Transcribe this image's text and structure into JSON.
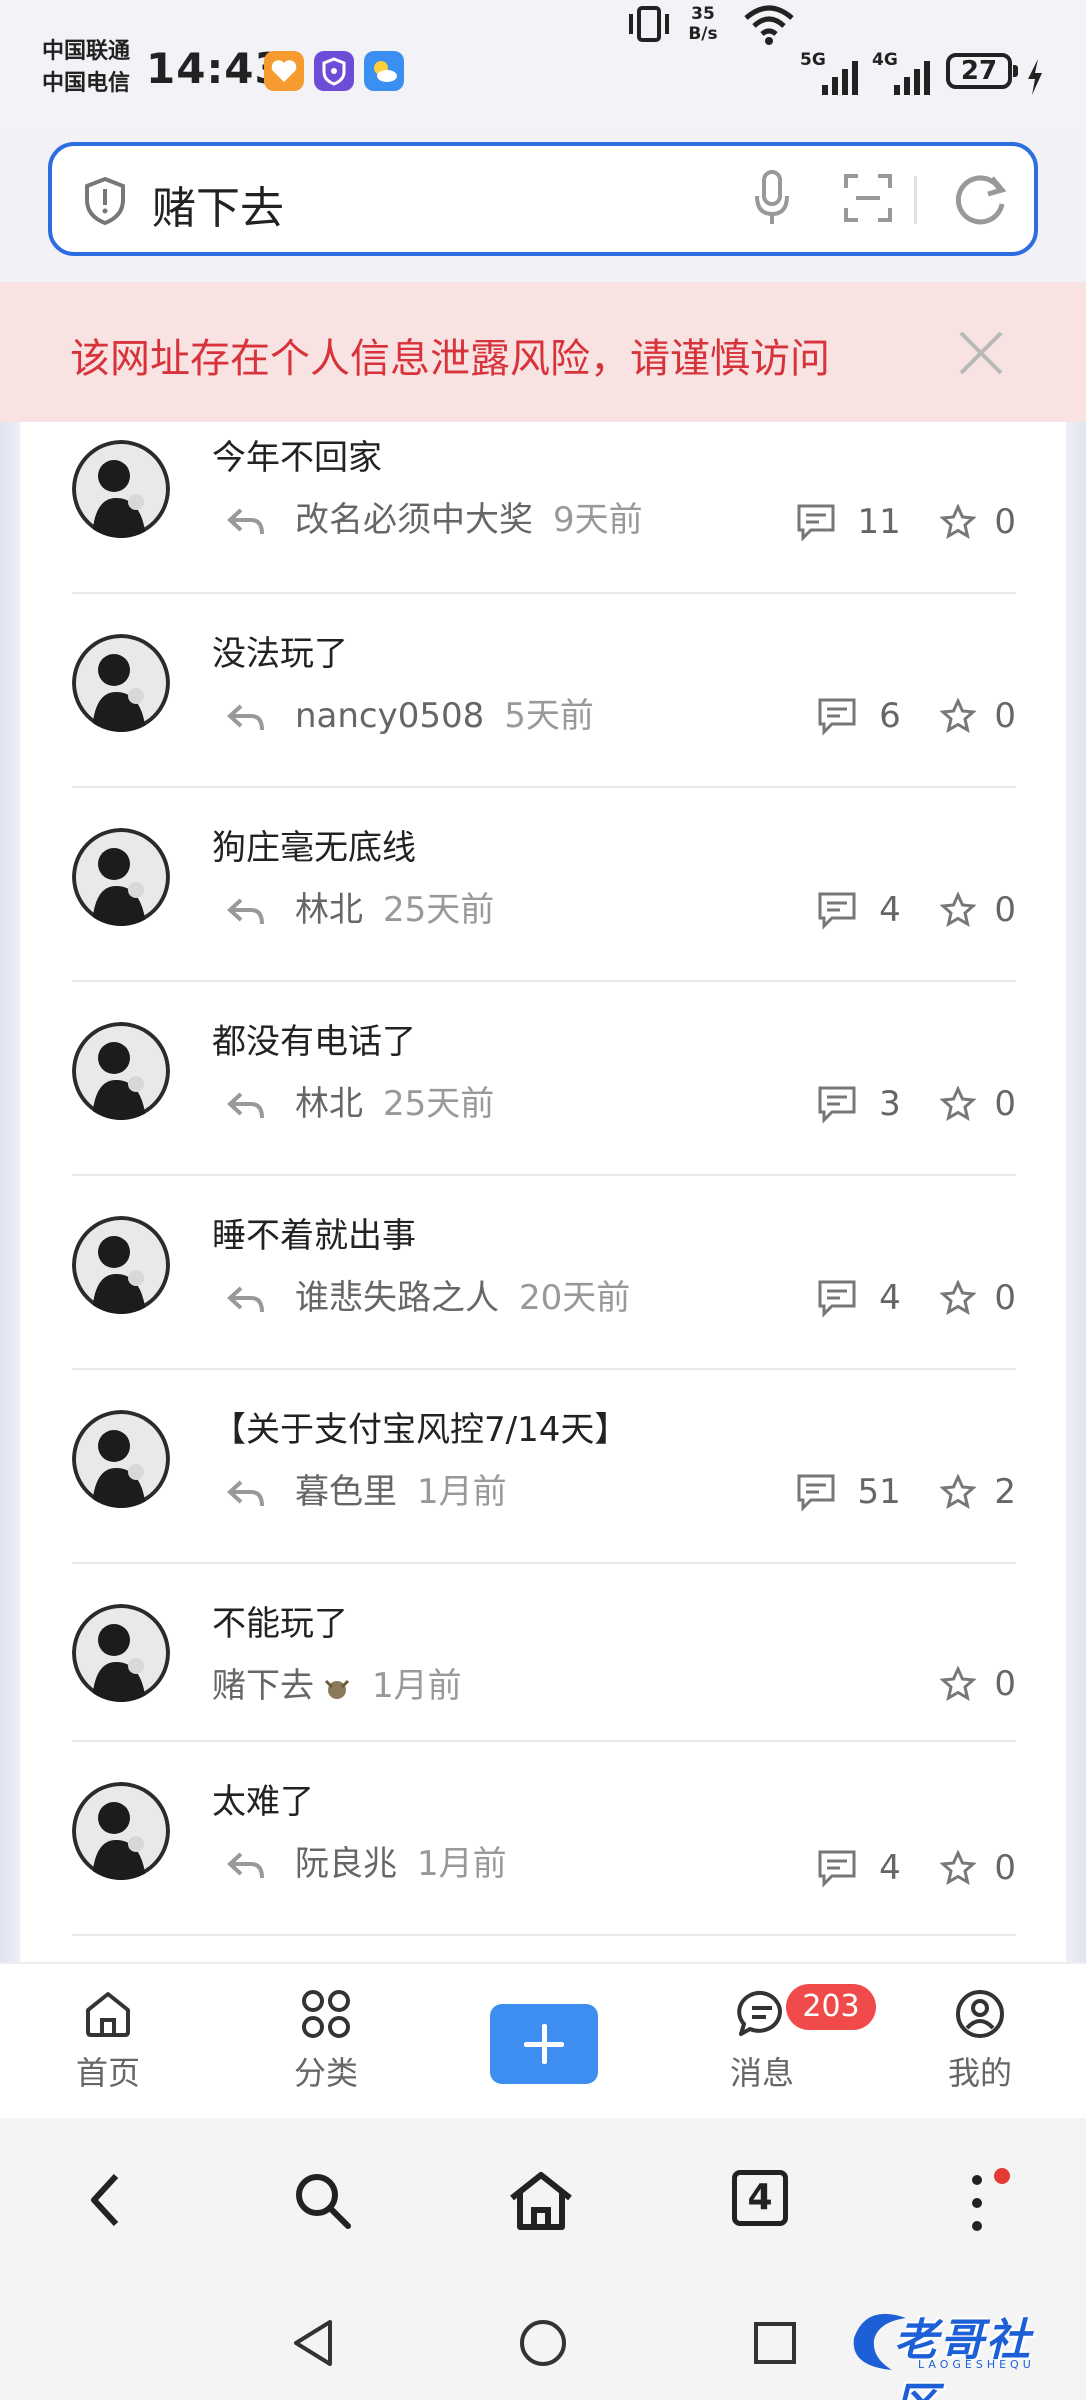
{
  "status_bar": {
    "carrier_1": "中国联通",
    "carrier_2": "中国电信",
    "time": "14:43",
    "net_speed_value": "35",
    "net_speed_unit": "B/s",
    "signal_1_label": "5G",
    "signal_2_label": "4G",
    "battery": "27"
  },
  "address_bar": {
    "query": "赌下去"
  },
  "warning": {
    "text": "该网址存在个人信息泄露风险，请谨慎访问"
  },
  "threads": [
    {
      "title": "今年不回家",
      "author": "改名必须中大奖",
      "time": "9天前",
      "comments": "11",
      "likes": "0",
      "has_reply_icon": true
    },
    {
      "title": "没法玩了",
      "author": "nancy0508",
      "time": "5天前",
      "comments": "6",
      "likes": "0",
      "has_reply_icon": true
    },
    {
      "title": "狗庄毫无底线",
      "author": "林北",
      "time": "25天前",
      "comments": "4",
      "likes": "0",
      "has_reply_icon": true
    },
    {
      "title": "都没有电话了",
      "author": "林北",
      "time": "25天前",
      "comments": "3",
      "likes": "0",
      "has_reply_icon": true
    },
    {
      "title": "睡不着就出事",
      "author": "谁悲失路之人",
      "time": "20天前",
      "comments": "4",
      "likes": "0",
      "has_reply_icon": true
    },
    {
      "title": "【关于支付宝风控7/14天】",
      "author": "暮色里",
      "time": "1月前",
      "comments": "51",
      "likes": "2",
      "has_reply_icon": true
    },
    {
      "title": "不能玩了",
      "author": "赌下去",
      "time": "1月前",
      "comments": "",
      "likes": "0",
      "has_reply_icon": false
    },
    {
      "title": "太难了",
      "author": "阮良兆",
      "time": "1月前",
      "comments": "4",
      "likes": "0",
      "has_reply_icon": true
    }
  ],
  "tabbar": {
    "home": "首页",
    "category": "分类",
    "messages": "消息",
    "messages_badge": "203",
    "mine": "我的"
  },
  "browser_bar": {
    "tab_count": "4"
  },
  "watermark": {
    "text": "老哥社区",
    "sub": "LAOGESHEQU"
  },
  "colors": {
    "accent": "#3d8ef0",
    "warning_bg": "#f8e2e2",
    "warning_text": "#d8333b",
    "badge": "#f04a4a",
    "address_border": "#2d6de0"
  },
  "icons": {
    "status": [
      "heart-app-icon",
      "vpn-shield-icon",
      "weather-icon",
      "vibrate-icon",
      "wifi-icon",
      "signal-icon",
      "battery-icon",
      "charging-icon"
    ],
    "address_bar": [
      "shield-icon",
      "microphone-icon",
      "scan-icon",
      "refresh-icon"
    ],
    "thread": [
      "reply-icon",
      "comment-icon",
      "star-icon"
    ],
    "tabbar": [
      "home-icon",
      "grid-icon",
      "plus-icon",
      "chat-icon",
      "user-icon"
    ],
    "browser": [
      "back-icon",
      "search-icon",
      "home-icon",
      "tabs-icon",
      "more-icon"
    ],
    "system": [
      "nav-back-icon",
      "nav-home-icon",
      "nav-recent-icon"
    ]
  }
}
